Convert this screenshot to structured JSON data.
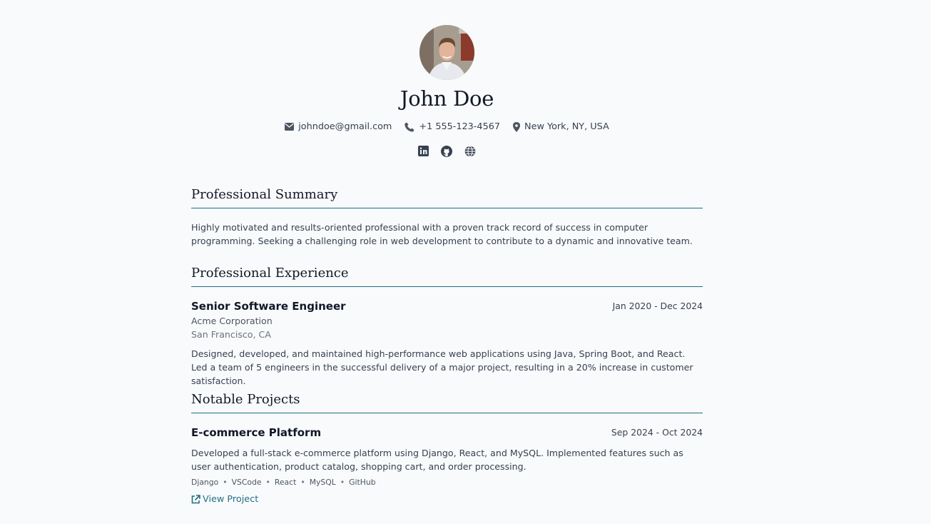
{
  "header": {
    "name": "John Doe",
    "avatar_alt": "profile-photo",
    "email": "johndoe@gmail.com",
    "phone": "+1 555-123-4567",
    "location": "New York, NY, USA",
    "social": [
      {
        "icon": "linkedin-icon"
      },
      {
        "icon": "github-icon"
      },
      {
        "icon": "globe-icon"
      }
    ]
  },
  "summary": {
    "title": "Professional Summary",
    "text": "Highly motivated and results-oriented professional with a proven track record of success in computer programming. Seeking a challenging role in web development to contribute to a dynamic and innovative team."
  },
  "experience": {
    "title": "Professional Experience",
    "jobs": [
      {
        "role": "Senior Software Engineer",
        "dates": "Jan 2020 - Dec 2024",
        "company": "Acme Corporation",
        "location": "San Francisco, CA",
        "description": "Designed, developed, and maintained high-performance web applications using Java, Spring Boot, and React. Led a team of 5 engineers in the successful delivery of a major project, resulting in a 20% increase in customer satisfaction."
      }
    ]
  },
  "projects": {
    "title": "Notable Projects",
    "items": [
      {
        "name": "E-commerce Platform",
        "dates": "Sep 2024 - Oct 2024",
        "description": "Developed a full-stack e-commerce platform using Django, React, and MySQL. Implemented features such as user authentication, product catalog, shopping cart, and order processing.",
        "tags": [
          "Django",
          "VSCode",
          "React",
          "MySQL",
          "GitHub"
        ],
        "link_label": "View Project"
      }
    ]
  },
  "colors": {
    "accent": "#1e6f86",
    "background": "#f9fafb",
    "text": "#374151",
    "heading": "#111827"
  }
}
